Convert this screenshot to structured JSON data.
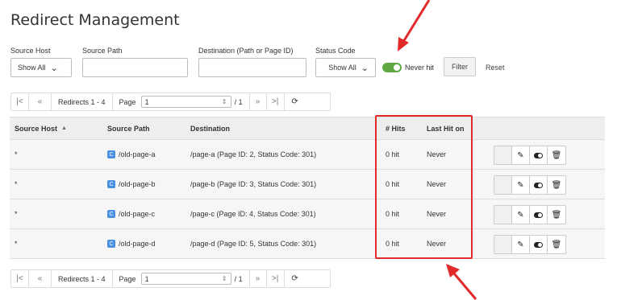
{
  "page_title": "Redirect Management",
  "filters": {
    "source_host_label": "Source Host",
    "source_host_value": "Show All",
    "source_path_label": "Source Path",
    "source_path_value": "",
    "destination_label": "Destination (Path or Page ID)",
    "destination_value": "",
    "status_code_label": "Status Code",
    "status_code_value": "Show All",
    "never_hit_label": "Never hit",
    "never_hit_on": true,
    "filter_label": "Filter",
    "reset_label": "Reset"
  },
  "pager": {
    "range": "Redirects 1 - 4",
    "page_label": "Page",
    "page_value": "1",
    "total": "/ 1"
  },
  "table": {
    "headers": {
      "source_host": "Source Host",
      "source_path": "Source Path",
      "destination": "Destination",
      "hits": "# Hits",
      "last_hit": "Last Hit on"
    },
    "rows": [
      {
        "host": "*",
        "path": "/old-page-a",
        "destination": "/page-a (Page ID: 2, Status Code: 301)",
        "hits": "0 hit",
        "last_hit": "Never"
      },
      {
        "host": "*",
        "path": "/old-page-b",
        "destination": "/page-b (Page ID: 3, Status Code: 301)",
        "hits": "0 hit",
        "last_hit": "Never"
      },
      {
        "host": "*",
        "path": "/old-page-c",
        "destination": "/page-c (Page ID: 4, Status Code: 301)",
        "hits": "0 hit",
        "last_hit": "Never"
      },
      {
        "host": "*",
        "path": "/old-page-d",
        "destination": "/page-d (Page ID: 5, Status Code: 301)",
        "hits": "0 hit",
        "last_hit": "Never"
      }
    ]
  },
  "colors": {
    "toggle_on": "#5fa843",
    "annotation_red": "#e22a2a",
    "page_icon": "#4a90e2"
  }
}
